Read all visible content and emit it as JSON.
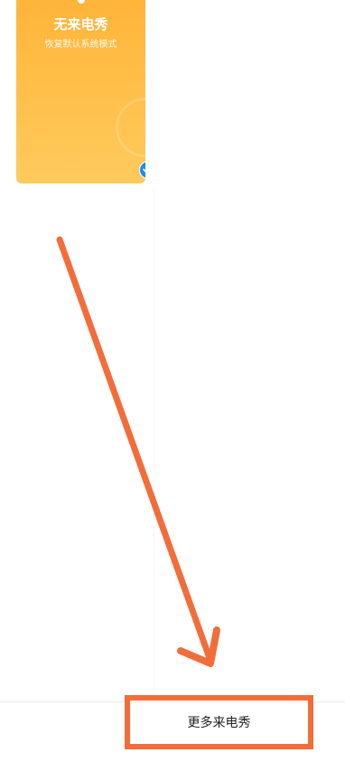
{
  "card": {
    "title": "无来电秀",
    "subtitle": "恢复默认系统模式",
    "selected": true,
    "accent": "#ffb43a",
    "check_color": "#1a8cf2",
    "icon": "checkmark-icon"
  },
  "bottom": {
    "more_label": "更多来电秀"
  },
  "annotation": {
    "color": "#f26d3a",
    "icon": "pointing-arrow"
  }
}
